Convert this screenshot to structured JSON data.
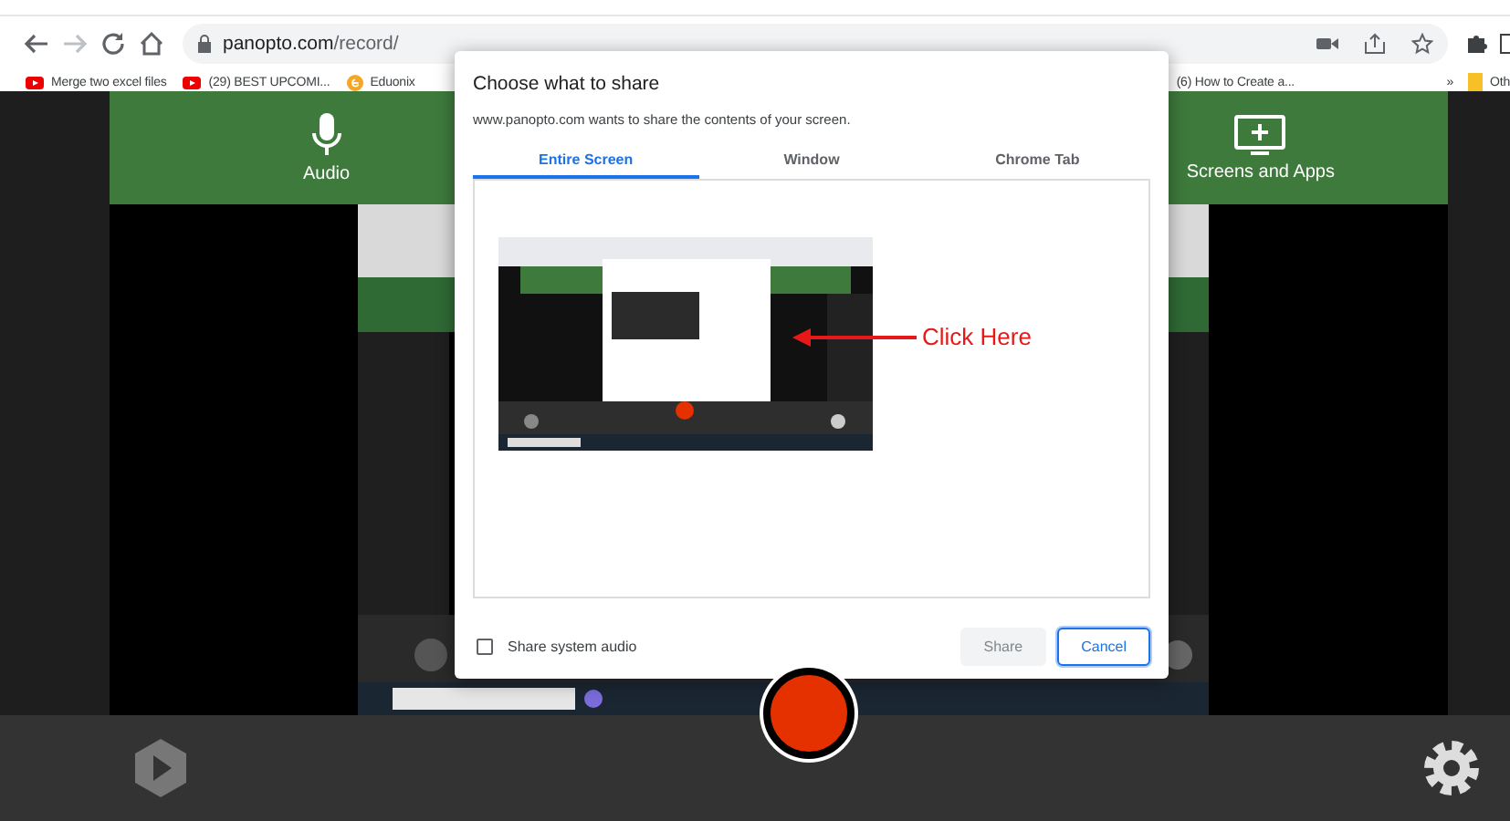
{
  "browser": {
    "address": {
      "host": "panopto.com",
      "path": "/record/"
    },
    "bookmarks": [
      {
        "label": "Merge two excel files",
        "kind": "youtube"
      },
      {
        "label": "(29) BEST UPCOMI...",
        "kind": "youtube"
      },
      {
        "label": "Eduonix",
        "kind": "eduonix"
      },
      {
        "label": "(6) How to Create a...",
        "kind": "plain"
      }
    ],
    "overflow": "»",
    "other": "Oth"
  },
  "recorder": {
    "sources": [
      {
        "label": "Audio",
        "kind": "mic"
      },
      {
        "label": "Screens and Apps",
        "kind": "screen"
      }
    ]
  },
  "dialog": {
    "title": "Choose what to share",
    "subtitle": "www.panopto.com wants to share the contents of your screen.",
    "tabs": [
      {
        "label": "Entire Screen",
        "selected": true
      },
      {
        "label": "Window",
        "selected": false
      },
      {
        "label": "Chrome Tab",
        "selected": false
      }
    ],
    "annotation": "Click Here",
    "checkbox": {
      "label": "Share system audio",
      "checked": false
    },
    "buttons": [
      {
        "label": "Share",
        "kind": "secondary",
        "disabled": true
      },
      {
        "label": "Cancel",
        "kind": "primary",
        "disabled": false
      }
    ]
  }
}
